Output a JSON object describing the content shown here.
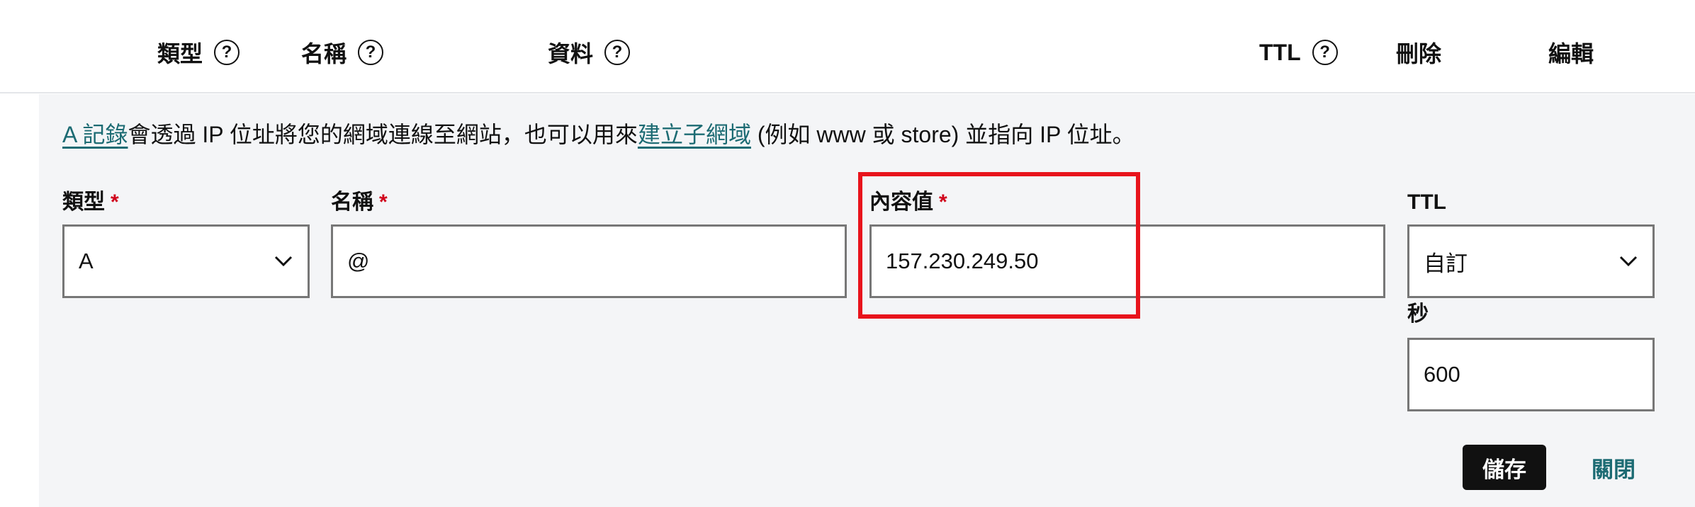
{
  "header": {
    "columns": [
      {
        "label": "類型",
        "help_icon": "question-circle-icon",
        "help_glyph": "?"
      },
      {
        "label": "名稱",
        "help_icon": "question-circle-icon",
        "help_glyph": "?"
      },
      {
        "label": "資料",
        "help_icon": "question-circle-icon",
        "help_glyph": "?"
      },
      {
        "label": "TTL",
        "help_icon": "question-circle-icon",
        "help_glyph": "?"
      },
      {
        "label": "刪除"
      },
      {
        "label": "編輯"
      }
    ]
  },
  "info": {
    "link_a_record": "A 記錄",
    "text_1": "會透過 IP 位址將您的網域連線至網站，也可以用來",
    "link_subdomain": "建立子網域",
    "text_2": " (例如 www 或 store) 並指向 IP 位址。"
  },
  "form": {
    "type": {
      "label": "類型",
      "required_mark": "*",
      "value": "A",
      "icon": "chevron-down-icon"
    },
    "name": {
      "label": "名稱",
      "required_mark": "*",
      "value": "@"
    },
    "content": {
      "label": "內容值",
      "required_mark": "*",
      "value": "157.230.249.50"
    },
    "ttl": {
      "label": "TTL",
      "value": "自訂",
      "icon": "chevron-down-icon"
    },
    "seconds": {
      "label": "秒",
      "value": "600"
    }
  },
  "actions": {
    "save_label": "儲存",
    "close_label": "關閉"
  },
  "colors": {
    "link": "#1c6b73",
    "required": "#d0021b",
    "highlight": "#e8141c",
    "panel_bg": "#f4f5f7",
    "save_bg": "#111111"
  }
}
